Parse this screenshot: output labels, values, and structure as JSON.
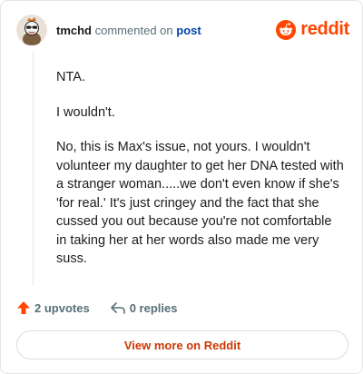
{
  "comment": {
    "username": "tmchd",
    "action_text": "commented on",
    "post_link": "post",
    "paragraphs": [
      "NTA.",
      "I wouldn't.",
      "No, this is Max's issue, not yours. I wouldn't volunteer my daughter to get her DNA tested with a stranger woman.....we don't even know if she's 'for real.' It's just cringey and the fact that she cussed you out because you're not comfortable in taking her at her words also made me very suss."
    ]
  },
  "brand": {
    "name": "reddit",
    "color": "#ff4500"
  },
  "footer": {
    "upvotes_label": "2 upvotes",
    "replies_label": "0 replies",
    "view_more_label": "View more on Reddit"
  }
}
